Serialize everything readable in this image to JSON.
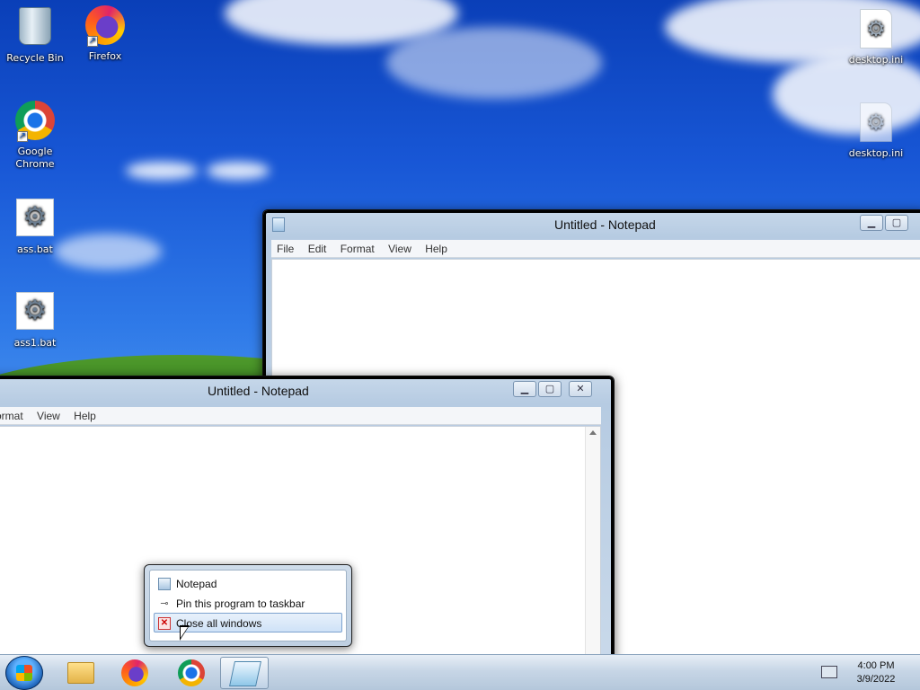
{
  "desktop_icons": {
    "recycle_bin": "Recycle Bin",
    "firefox": "Firefox",
    "chrome": "Google Chrome",
    "ass_bat": "ass.bat",
    "ass1_bat": "ass1.bat",
    "desktop_ini_1": "desktop.ini",
    "desktop_ini_2": "desktop.ini"
  },
  "windows": {
    "back": {
      "title": "Untitled - Notepad",
      "menu": [
        "File",
        "Edit",
        "Format",
        "View",
        "Help"
      ]
    },
    "front": {
      "title": "Untitled - Notepad",
      "menu": [
        "ormat",
        "View",
        "Help"
      ]
    }
  },
  "jump_list": {
    "items": [
      {
        "label": "Notepad",
        "icon": "notepad-icon"
      },
      {
        "label": "Pin this program to taskbar",
        "icon": "pin-icon"
      },
      {
        "label": "Close all windows",
        "icon": "close-icon",
        "highlighted": true
      }
    ]
  },
  "taskbar": {
    "clock_time": "4:00 PM",
    "clock_date": "3/9/2022",
    "pinned": [
      "start-button",
      "file-explorer-icon",
      "firefox-icon",
      "chrome-icon",
      "notepad-icon"
    ]
  },
  "colors": {
    "wallpaper_top": "#0a3fb8",
    "highlight": "#cfe2f7"
  }
}
